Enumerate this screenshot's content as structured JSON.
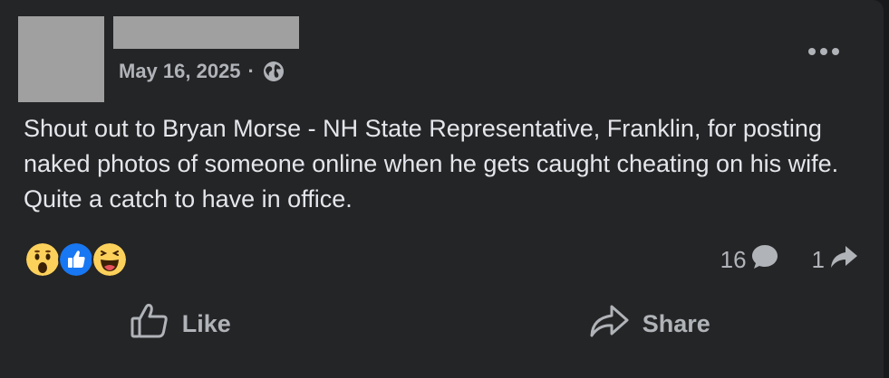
{
  "post": {
    "date": "May 16, 2025",
    "separator": "·",
    "audience_icon": "globe-icon",
    "body": "Shout out to Bryan Morse - NH State Representative, Franklin, for posting naked photos of someone online when he gets caught cheating on his wife. Quite a catch to have in office.",
    "reactions": [
      "wow-reaction-icon",
      "like-reaction-icon",
      "haha-reaction-icon"
    ],
    "comment_count": "16",
    "share_count": "1"
  },
  "actions": {
    "like_label": "Like",
    "share_label": "Share"
  },
  "colors": {
    "card_bg": "#242526",
    "text_primary": "#e4e6eb",
    "text_secondary": "#b0b3b8",
    "like_blue": "#1877f2",
    "emoji_yellow": "#fcd15b"
  }
}
